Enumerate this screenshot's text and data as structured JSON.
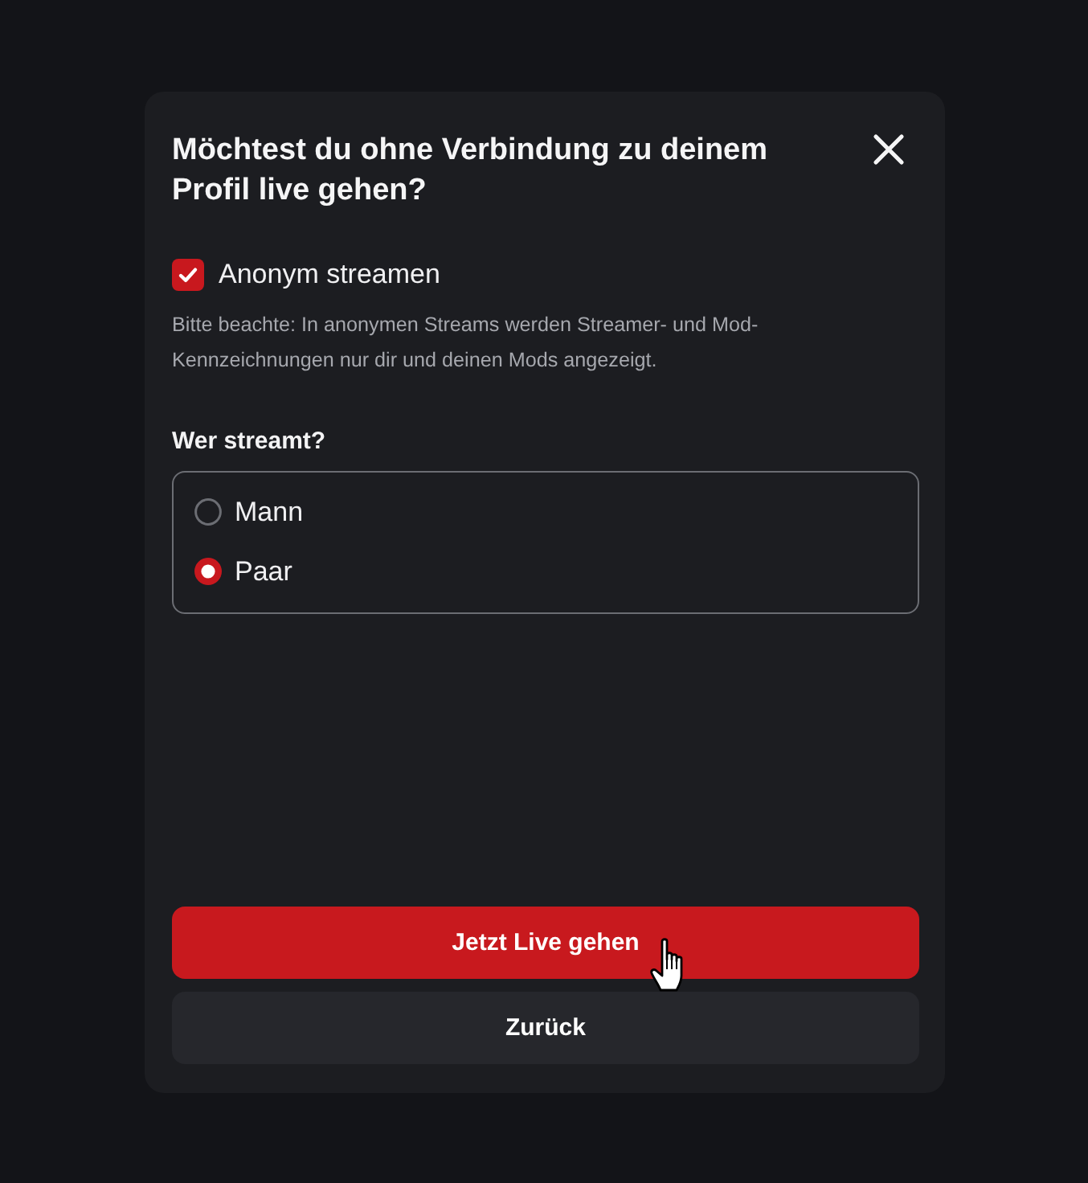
{
  "dialog": {
    "title": "Möchtest du ohne Verbindung zu deinem Profil live gehen?",
    "anonymous": {
      "label": "Anonym streamen",
      "checked": true
    },
    "note": "Bitte beachte: In anonymen Streams werden Streamer- und Mod-Kennzeichnungen nur dir und deinen Mods angezeigt.",
    "question": "Wer streamt?",
    "options": [
      {
        "label": "Mann",
        "selected": false
      },
      {
        "label": "Paar",
        "selected": true
      }
    ],
    "buttons": [
      {
        "label": "Jetzt Live gehen",
        "kind": "primary"
      },
      {
        "label": "Zurück",
        "kind": "secondary"
      }
    ]
  }
}
